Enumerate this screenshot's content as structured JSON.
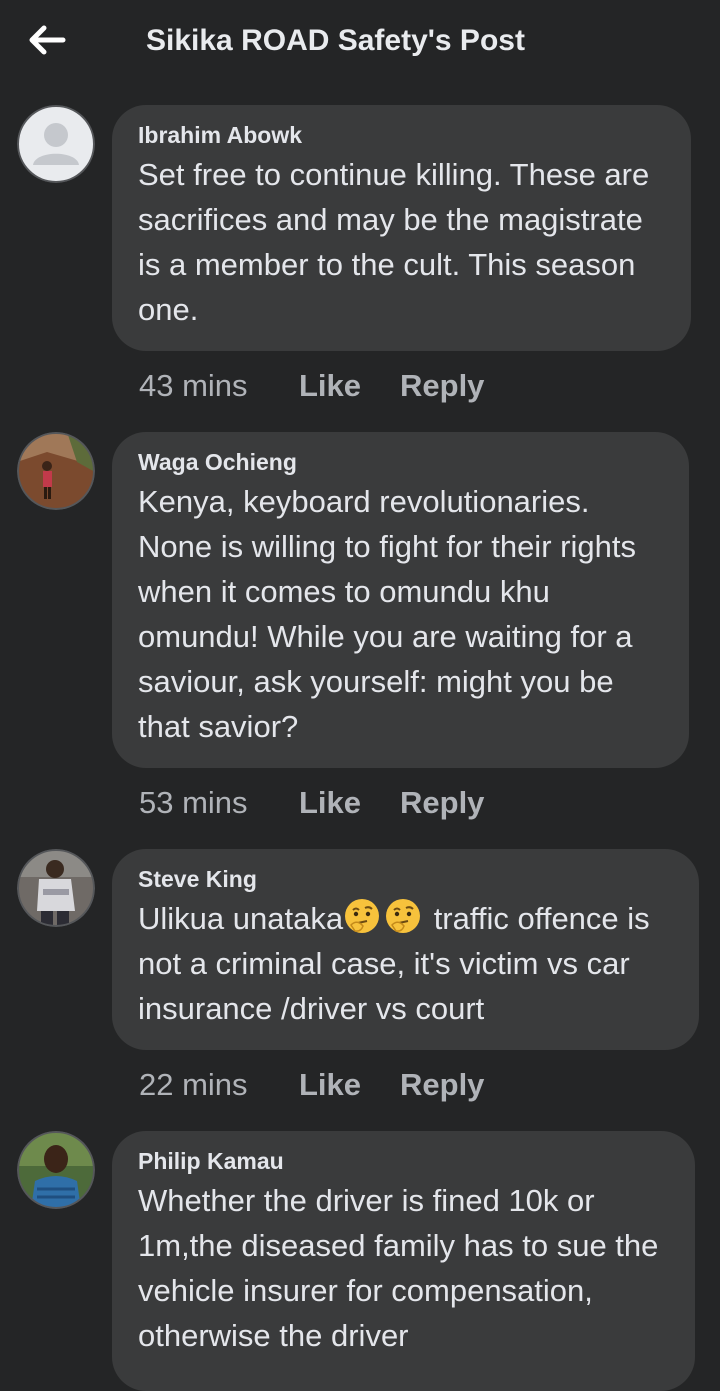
{
  "header": {
    "title": "Sikika ROAD Safety's Post",
    "back_icon": "arrow-left-icon"
  },
  "comments": [
    {
      "author": "Ibrahim Abowk",
      "avatar_icon": "default-avatar-icon",
      "text": "Set free to continue killing. These are sacrifices and may be the magistrate is a member to the cult. This season one.",
      "time": "43 mins",
      "like_label": "Like",
      "reply_label": "Reply"
    },
    {
      "author": "Waga Ochieng",
      "avatar_icon": "user-photo-avatar",
      "text": "Kenya, keyboard revolutionaries. None is willing to fight for their rights when it comes to omundu khu omundu! While you are waiting for a saviour, ask yourself: might you be that savior?",
      "time": "53 mins",
      "like_label": "Like",
      "reply_label": "Reply"
    },
    {
      "author": "Steve King",
      "avatar_icon": "user-photo-avatar",
      "text_before_emoji": "Ulikua unataka",
      "emojis": [
        "thinking-face-emoji",
        "thinking-face-emoji"
      ],
      "text_after_emoji": " traffic offence is not a criminal case, it's victim vs car insurance /driver vs court",
      "time": "22 mins",
      "like_label": "Like",
      "reply_label": "Reply"
    },
    {
      "author": "Philip Kamau",
      "avatar_icon": "user-photo-avatar",
      "text": "Whether the driver is fined 10k or 1m,the diseased family has to sue the vehicle insurer for compensation, otherwise the driver"
    }
  ],
  "colors": {
    "background": "#242526",
    "bubble": "#3a3b3c",
    "primary_text": "#e4e6eb",
    "secondary_text": "#b0b3b8"
  }
}
